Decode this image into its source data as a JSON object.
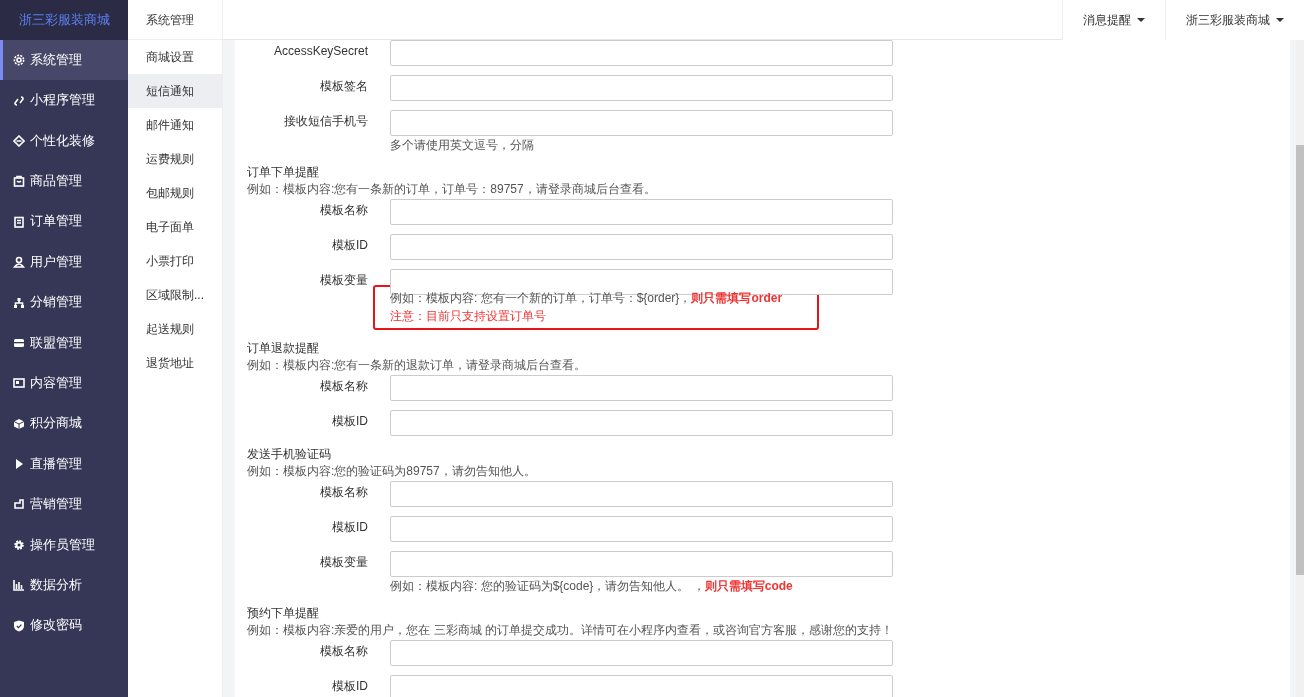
{
  "brand": "浙三彩服装商城",
  "sidebar": {
    "items": [
      {
        "label": "系统管理",
        "selected": true
      },
      {
        "label": "小程序管理",
        "selected": false
      },
      {
        "label": "个性化装修",
        "selected": false
      },
      {
        "label": "商品管理",
        "selected": false
      },
      {
        "label": "订单管理",
        "selected": false
      },
      {
        "label": "用户管理",
        "selected": false
      },
      {
        "label": "分销管理",
        "selected": false
      },
      {
        "label": "联盟管理",
        "selected": false
      },
      {
        "label": "内容管理",
        "selected": false
      },
      {
        "label": "积分商城",
        "selected": false
      },
      {
        "label": "直播管理",
        "selected": false
      },
      {
        "label": "营销管理",
        "selected": false
      },
      {
        "label": "操作员管理",
        "selected": false
      },
      {
        "label": "数据分析",
        "selected": false
      },
      {
        "label": "修改密码",
        "selected": false
      }
    ]
  },
  "submenu": {
    "title": "系统管理",
    "items": [
      {
        "label": "商城设置",
        "selected": false
      },
      {
        "label": "短信通知",
        "selected": true
      },
      {
        "label": "邮件通知",
        "selected": false
      },
      {
        "label": "运费规则",
        "selected": false
      },
      {
        "label": "包邮规则",
        "selected": false
      },
      {
        "label": "电子面单",
        "selected": false
      },
      {
        "label": "小票打印",
        "selected": false
      },
      {
        "label": "区域限制...",
        "selected": false
      },
      {
        "label": "起送规则",
        "selected": false
      },
      {
        "label": "退货地址",
        "selected": false
      }
    ]
  },
  "topbar": {
    "menus": [
      {
        "label": "消息提醒"
      },
      {
        "label": "浙三彩服装商城"
      }
    ]
  },
  "form": [
    {
      "kind": "field",
      "label": "AccessKeySecret"
    },
    {
      "kind": "field",
      "label": "模板签名"
    },
    {
      "kind": "field",
      "label": "接收短信手机号",
      "help": [
        {
          "kind": "note",
          "text": "多个请使用英文逗号，分隔"
        }
      ]
    },
    {
      "kind": "heading",
      "title": "订单下单提醒",
      "example": "例如：模板内容:您有一条新的订单，订单号：89757，请登录商城后台查看。"
    },
    {
      "kind": "field",
      "label": "模板名称"
    },
    {
      "kind": "field",
      "label": "模板ID"
    },
    {
      "kind": "field",
      "label": "模板变量",
      "boxed": true,
      "help": [
        {
          "kind": "note",
          "text": "例如：模板内容: 您有一个新的订单，订单号：${order}，**则只需填写order**"
        },
        {
          "kind": "warning",
          "text": "注意：目前只支持设置订单号"
        }
      ]
    },
    {
      "kind": "heading",
      "title": "订单退款提醒",
      "example": "例如：模板内容:您有一条新的退款订单，请登录商城后台查看。"
    },
    {
      "kind": "field",
      "label": "模板名称"
    },
    {
      "kind": "field",
      "label": "模板ID"
    },
    {
      "kind": "heading",
      "title": "发送手机验证码",
      "example": "例如：模板内容:您的验证码为89757，请勿告知他人。"
    },
    {
      "kind": "field",
      "label": "模板名称"
    },
    {
      "kind": "field",
      "label": "模板ID"
    },
    {
      "kind": "field",
      "label": "模板变量",
      "help": [
        {
          "kind": "note",
          "text": "例如：模板内容: 您的验证码为${code}，请勿告知他人。 ，**则只需填写code**"
        }
      ]
    },
    {
      "kind": "heading",
      "title": "预约下单提醒",
      "example": "例如：模板内容:亲爱的用户，您在 三彩商城 的订单提交成功。详情可在小程序内查看，或咨询官方客服，感谢您的支持！"
    },
    {
      "kind": "field",
      "label": "模板名称"
    },
    {
      "kind": "field",
      "label": "模板ID"
    }
  ]
}
